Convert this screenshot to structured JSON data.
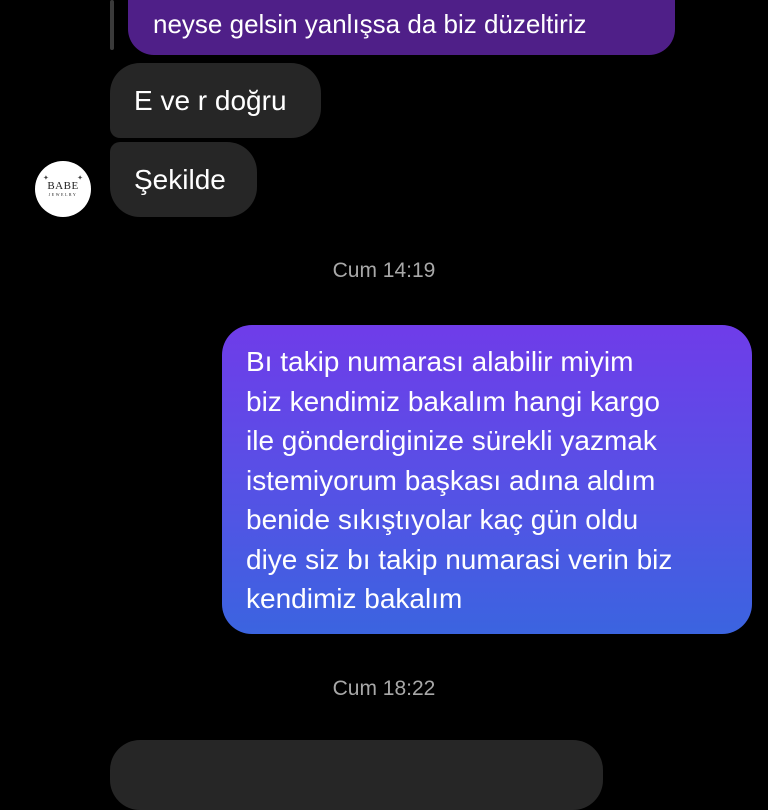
{
  "conversation": {
    "quoted_message": "neyse gelsin yanlışsa da biz düzeltiriz",
    "incoming": [
      {
        "text": "E ve r doğru"
      },
      {
        "text": "Şekilde"
      }
    ],
    "avatar": {
      "brand": "BABE",
      "subtext": "JEWELRY"
    },
    "timestamp_1": "Cum 14:19",
    "outgoing": {
      "lines": [
        "Bı takip numarası alabilir miyim",
        "biz kendimiz bakalım hangi kargo",
        "ile gönderdiginize sürekli yazmak",
        "istemiyorum başkası adına aldım",
        "benide sıkıştıyolar kaç gün oldu",
        "diye siz bı takip numarasi verin biz",
        "kendimiz bakalım"
      ]
    },
    "timestamp_2": "Cum 18:22"
  },
  "colors": {
    "background": "#000000",
    "incoming_bubble": "#262626",
    "quoted_bubble": "#4f1f88",
    "outgoing_gradient_top": "#6f3ce9",
    "outgoing_gradient_bottom": "#3b64e0",
    "timestamp_text": "#a8a8a8"
  }
}
